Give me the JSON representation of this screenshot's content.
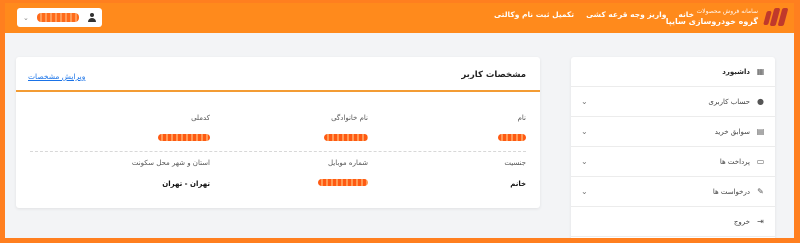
{
  "header": {
    "brand_sub": "سامانه فروش محصولات",
    "brand_title": "گروه خودروسازی سایپا",
    "nav": [
      "خانه",
      "واریز وجه قرعه کشی",
      "تکمیل ثبت نام وکالتی"
    ],
    "user_chevron": "⌄"
  },
  "profile": {
    "title": "مشخصات کاربر",
    "edit_label": "ویرایش مشخصات",
    "fields": {
      "first_name_label": "نام",
      "last_name_label": "نام خانوادگی",
      "national_code_label": "کدملی",
      "gender_label": "جنسیت",
      "gender_value": "خانم",
      "mobile_label": "شماره موبایل",
      "city_label": "استان و شهر محل سکونت",
      "city_value": "تهران - تهران"
    }
  },
  "sidebar": {
    "items": [
      {
        "label": "داشبورد",
        "icon": "dashboard-icon"
      },
      {
        "label": "حساب کاربری",
        "icon": "user-icon"
      },
      {
        "label": "سوابق خرید",
        "icon": "document-icon"
      },
      {
        "label": "پرداخت ها",
        "icon": "payment-icon"
      },
      {
        "label": "درخواست ها",
        "icon": "request-icon"
      },
      {
        "label": "خروج",
        "icon": "logout-icon"
      }
    ]
  },
  "colors": {
    "accent": "#ff8a1c",
    "link": "#1a73e8",
    "divider": "#f39c34"
  }
}
